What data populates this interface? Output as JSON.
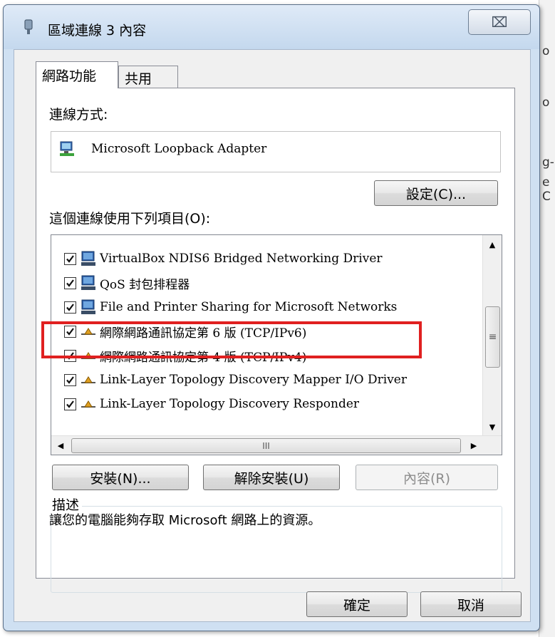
{
  "window": {
    "title": "區域連線 3 內容",
    "close_symbol": "⌧"
  },
  "tabs": [
    {
      "label": "網路功能",
      "active": true
    },
    {
      "label": "共用",
      "active": false
    }
  ],
  "networking": {
    "connect_using_label": "連線方式:",
    "adapter_name": "Microsoft Loopback Adapter",
    "configure_label": "設定(C)...",
    "items_label": "這個連線使用下列項目(O):",
    "items": [
      {
        "label": "VirtualBox NDIS6 Bridged Networking Driver",
        "checked": true,
        "icon": "network-client-icon"
      },
      {
        "label": "QoS 封包排程器",
        "checked": true,
        "icon": "network-client-icon"
      },
      {
        "label": "File and Printer Sharing for Microsoft Networks",
        "checked": true,
        "icon": "network-client-icon"
      },
      {
        "label": "網際網路通訊協定第 6 版 (TCP/IPv6)",
        "checked": true,
        "icon": "protocol-icon"
      },
      {
        "label": "網際網路通訊協定第 4 版 (TCP/IPv4)",
        "checked": true,
        "icon": "protocol-icon",
        "highlighted": true
      },
      {
        "label": "Link-Layer Topology Discovery Mapper I/O Driver",
        "checked": true,
        "icon": "protocol-icon"
      },
      {
        "label": "Link-Layer Topology Discovery Responder",
        "checked": true,
        "icon": "protocol-icon"
      }
    ],
    "scroll_grip": "≡",
    "hscroll_grip": "III",
    "install_label": "安裝(N)...",
    "uninstall_label": "解除安裝(U)",
    "properties_label": "內容(R)",
    "properties_enabled": false,
    "description_legend": "描述",
    "description_text": "讓您的電腦能夠存取 Microsoft 網路上的資源。"
  },
  "footer": {
    "ok_label": "確定",
    "cancel_label": "取消"
  },
  "background_window": {
    "fragments": [
      "o",
      "o",
      "g-",
      "e C"
    ]
  },
  "colors": {
    "highlight_border": "#e02020",
    "frame": "#cfe0f2"
  }
}
